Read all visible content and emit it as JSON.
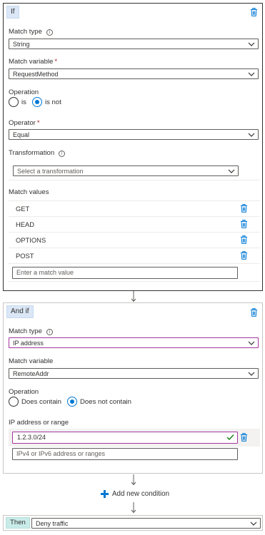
{
  "if_block": {
    "label": "If",
    "match_type": {
      "label": "Match type",
      "value": "String"
    },
    "match_variable": {
      "label": "Match variable",
      "required": "*",
      "value": "RequestMethod"
    },
    "operation": {
      "label": "Operation",
      "options": [
        "is",
        "is not"
      ],
      "selected": "is not"
    },
    "operator": {
      "label": "Operator",
      "required": "*",
      "value": "Equal"
    },
    "transformation": {
      "label": "Transformation",
      "placeholder": "Select a transformation"
    },
    "match_values": {
      "label": "Match values",
      "items": [
        "GET",
        "HEAD",
        "OPTIONS",
        "POST"
      ],
      "input_placeholder": "Enter a match value"
    }
  },
  "and_if_block": {
    "label": "And if",
    "match_type": {
      "label": "Match type",
      "value": "IP address"
    },
    "match_variable": {
      "label": "Match variable",
      "value": "RemoteAddr"
    },
    "operation": {
      "label": "Operation",
      "options": [
        "Does contain",
        "Does not contain"
      ],
      "selected": "Does not contain"
    },
    "ip_range": {
      "label": "IP address or range",
      "value": "1.2.3.0/24",
      "placeholder": "IPv4 or IPv6 address or ranges"
    }
  },
  "add_condition": "Add new condition",
  "then_block": {
    "label": "Then",
    "action": "Deny traffic"
  },
  "colors": {
    "accent": "#0078d4",
    "focus_border": "#a5359f",
    "if_pill": "#dbe7f6",
    "then_pill": "#c9ece9",
    "required": "#a4262c",
    "valid_check": "#107c10"
  }
}
